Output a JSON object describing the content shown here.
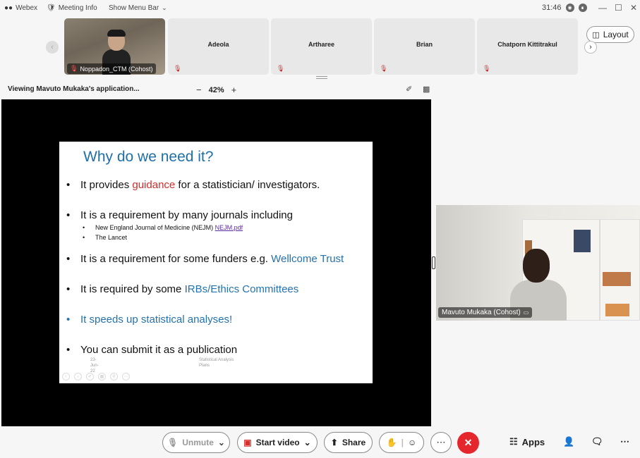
{
  "titlebar": {
    "app_name": "Webex",
    "meeting_info": "Meeting Info",
    "show_menu": "Show Menu Bar",
    "time": "31:46"
  },
  "participants": [
    {
      "name": "Noppadon_CTM (Cohost)"
    },
    {
      "name": "Adeola"
    },
    {
      "name": "Artharee"
    },
    {
      "name": "Brian"
    },
    {
      "name": "Chatporn Kittitrakul"
    }
  ],
  "layout_label": "Layout",
  "viewing": {
    "label": "Viewing Mavuto Mukaka's application...",
    "zoom": "42%",
    "zoom_out": "−",
    "zoom_in": "+"
  },
  "slide": {
    "title": "Why do we need it?",
    "b1": {
      "pre": "It provides ",
      "hl": "guidance",
      "post": " for a statistician/ investigators."
    },
    "b2": "It is a requirement by many journals including",
    "b2_sub1_text": "New England Journal of Medicine (NEJM) ",
    "b2_sub1_link": "NEJM.pdf",
    "b2_sub2": "The Lancet",
    "b3": {
      "pre": "It is a requirement for some funders e.g. ",
      "hl": "Wellcome Trust"
    },
    "b4": {
      "pre": "It is required by some ",
      "hl": "IRBs/Ethics Committees"
    },
    "b5": "It speeds up statistical analyses!",
    "b6": "You can submit it as a publication",
    "footer_date_1": "23-",
    "footer_date_2": "Jun-",
    "footer_date_3": "22",
    "footer_title_1": "Statistical Analysis",
    "footer_title_2": "Plans"
  },
  "speaker": {
    "name": "Mavuto Mukaka (Cohost)"
  },
  "controls": {
    "unmute": "Unmute",
    "start_video": "Start video",
    "share": "Share",
    "apps": "Apps"
  },
  "colors": {
    "end_call": "#e5262c",
    "accent_blue": "#2472b0",
    "highlight_red": "#d62b2b"
  }
}
